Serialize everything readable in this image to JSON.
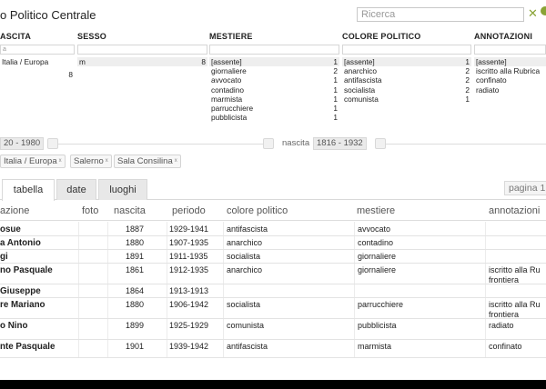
{
  "app": {
    "title": "o Politico Centrale"
  },
  "search": {
    "placeholder": "Ricerca"
  },
  "facets": {
    "nascita": {
      "header": "ASCITA",
      "input_hint": "a",
      "items": [
        {
          "label": "Italia / Europa",
          "count": ""
        },
        {
          "label": "",
          "count": "8"
        }
      ]
    },
    "sesso": {
      "header": "SESSO",
      "items": [
        {
          "label": "m",
          "count": "8"
        }
      ]
    },
    "mestiere": {
      "header": "MESTIERE",
      "items": [
        {
          "label": "[assente]",
          "count": "1"
        },
        {
          "label": "giornaliere",
          "count": "2"
        },
        {
          "label": "avvocato",
          "count": "1"
        },
        {
          "label": "contadino",
          "count": "1"
        },
        {
          "label": "marmista",
          "count": "1"
        },
        {
          "label": "parrucchiere",
          "count": "1"
        },
        {
          "label": "pubblicista",
          "count": "1"
        }
      ]
    },
    "colore_politico": {
      "header": "COLORE POLITICO",
      "items": [
        {
          "label": "[assente]",
          "count": "1"
        },
        {
          "label": "anarchico",
          "count": "2"
        },
        {
          "label": "antifascista",
          "count": "2"
        },
        {
          "label": "socialista",
          "count": "2"
        },
        {
          "label": "comunista",
          "count": "1"
        }
      ]
    },
    "annotazioni": {
      "header": "ANNOTAZIONI",
      "items": [
        {
          "label": "[assente]",
          "count": ""
        },
        {
          "label": "iscritto alla Rubrica",
          "count": ""
        },
        {
          "label": "confinato",
          "count": ""
        },
        {
          "label": "radiato",
          "count": ""
        }
      ]
    }
  },
  "ranges": {
    "periodo": "20 - 1980",
    "nascita_label": "nascita",
    "nascita": "1816 - 1932"
  },
  "chips": [
    {
      "label": "Italia / Europa",
      "x": "x"
    },
    {
      "label": "Salerno",
      "x": "x"
    },
    {
      "label": "Sala Consilina",
      "x": "x"
    }
  ],
  "tabs": [
    {
      "label": "tabella",
      "active": true
    },
    {
      "label": "date",
      "active": false
    },
    {
      "label": "luoghi",
      "active": false
    }
  ],
  "pager": {
    "label": "pagina 1"
  },
  "table": {
    "headers": {
      "denominazione": "azione",
      "foto": "foto",
      "nascita": "nascita",
      "periodo": "periodo",
      "colore": "colore politico",
      "mestiere": "mestiere",
      "annotazioni": "annotazioni"
    },
    "rows": [
      {
        "name": "osue",
        "nascita": "1887",
        "periodo": "1929-1941",
        "colore": "antifascista",
        "mestiere": "avvocato",
        "annotazioni": ""
      },
      {
        "name": "a Antonio",
        "nascita": "1880",
        "periodo": "1907-1935",
        "colore": "anarchico",
        "mestiere": "contadino",
        "annotazioni": ""
      },
      {
        "name": "gi",
        "nascita": "1891",
        "periodo": "1911-1935",
        "colore": "socialista",
        "mestiere": "giornaliere",
        "annotazioni": ""
      },
      {
        "name": "no Pasquale",
        "nascita": "1861",
        "periodo": "1912-1935",
        "colore": "anarchico",
        "mestiere": "giornaliere",
        "annotazioni": "iscritto alla Ru frontiera"
      },
      {
        "name": "Giuseppe",
        "nascita": "1864",
        "periodo": "1913-1913",
        "colore": "",
        "mestiere": "",
        "annotazioni": ""
      },
      {
        "name": "re Mariano",
        "nascita": "1880",
        "periodo": "1906-1942",
        "colore": "socialista",
        "mestiere": "parrucchiere",
        "annotazioni": "iscritto alla Ru frontiera"
      },
      {
        "name": "o Nino",
        "nascita": "1899",
        "periodo": "1925-1929",
        "colore": "comunista",
        "mestiere": "pubblicista",
        "annotazioni": "radiato"
      },
      {
        "name": "nte Pasquale",
        "nascita": "1901",
        "periodo": "1939-1942",
        "colore": "antifascista",
        "mestiere": "marmista",
        "annotazioni": "confinato"
      }
    ]
  },
  "colors": {
    "accent": "#8aa336",
    "selected_row": "#eeeeee",
    "border": "#d9d9d9"
  }
}
